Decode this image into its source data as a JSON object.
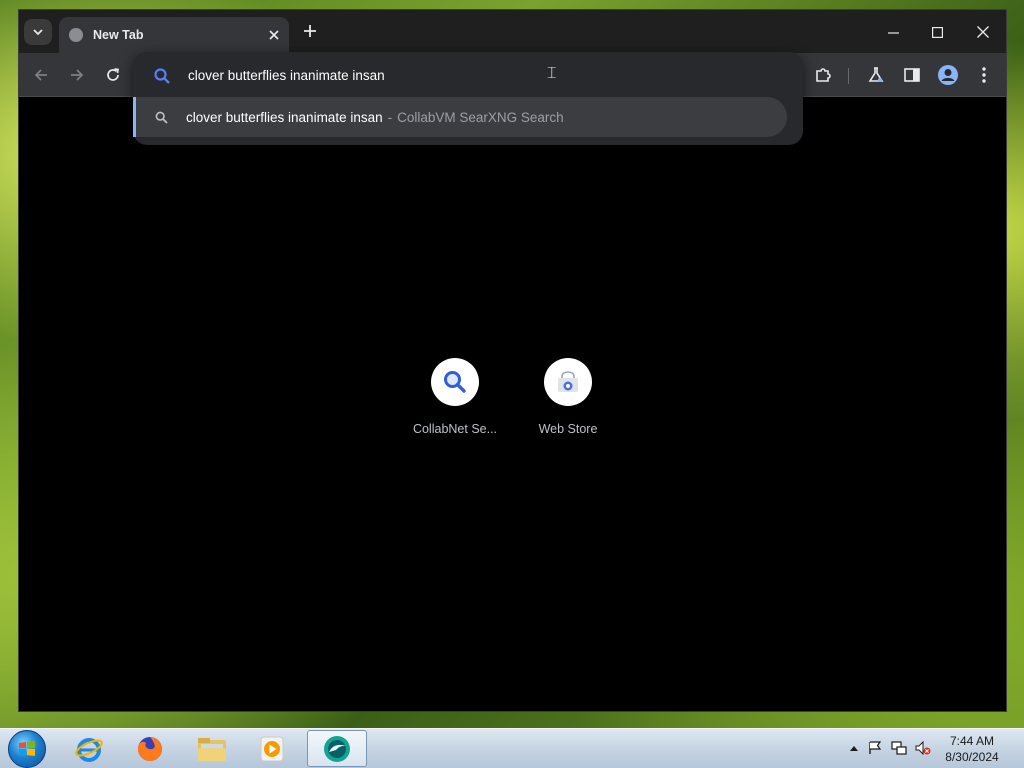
{
  "browser": {
    "tab_title": "New Tab",
    "omnibox": {
      "value": "clover butterflies inanimate insan",
      "suggestion": {
        "query": "clover butterflies inanimate insan",
        "separator": "-",
        "provider": "CollabVM SearXNG Search"
      }
    },
    "shortcuts": [
      {
        "label": "CollabNet Se...",
        "icon": "magnifier-icon"
      },
      {
        "label": "Web Store",
        "icon": "web-store-icon"
      }
    ]
  },
  "taskbar": {
    "clock": {
      "time": "7:44 AM",
      "date": "8/30/2024"
    },
    "pinned": [
      "internet-explorer-icon",
      "firefox-icon",
      "file-explorer-icon",
      "media-player-icon",
      "chrome-icon"
    ]
  },
  "colors": {
    "accent": "#8ab4f8",
    "toolbar_bg": "#35363a",
    "omnibox_bg": "#28292c",
    "page_bg": "#000000"
  }
}
